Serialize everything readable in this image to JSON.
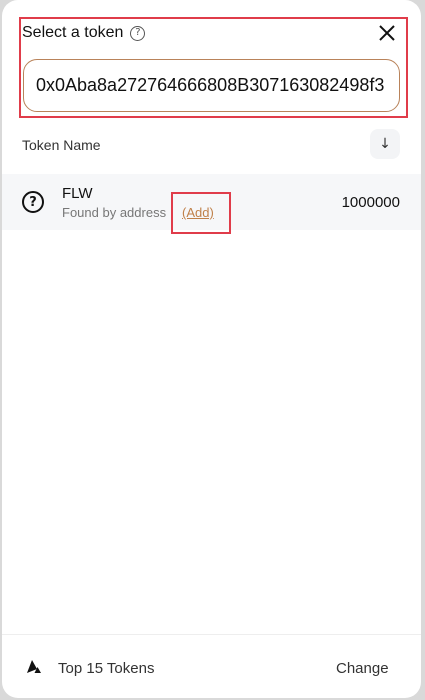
{
  "modal": {
    "title": "Select a token",
    "help_icon": "question-circle-icon",
    "close_icon": "close-x-icon"
  },
  "search": {
    "value": "0x0Aba8a272764666808B307163082498f3",
    "display_value": "DAba8a272764666808B307163082498f3"
  },
  "list": {
    "column_header": "Token Name",
    "sort_icon": "↓",
    "tokens": [
      {
        "symbol": "FLW",
        "subtitle": "Found by address",
        "add_label": "(Add)",
        "balance": "1000000",
        "icon": "?"
      }
    ]
  },
  "footer": {
    "label": "Top 15 Tokens",
    "action": "Change",
    "logo_icon": "avalanche-logo-icon"
  },
  "colors": {
    "highlight": "#e03c4a",
    "accent": "#c0814a",
    "input_border": "#b9835a"
  }
}
